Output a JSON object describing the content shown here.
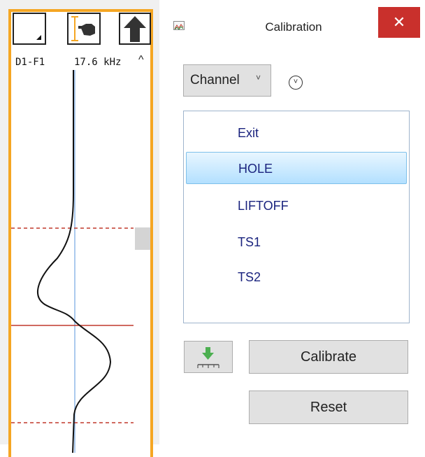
{
  "strip": {
    "channel_label": "D1-F1",
    "frequency_label": "17.6 kHz",
    "scroll_up_glyph": "^",
    "toolbar_icons": [
      "corner-toggle-icon",
      "hand-pointer-icon",
      "up-arrow-icon"
    ]
  },
  "dialog": {
    "title": "Calibration",
    "close_glyph": "✕",
    "channel_dropdown": {
      "value": "Channel",
      "chevron": "˅"
    },
    "expand_glyph": "˅",
    "list_items": [
      "Exit",
      "HOLE",
      "LIFTOFF",
      "TS1",
      "TS2"
    ],
    "selected_item": "HOLE",
    "calibrate_label": "Calibrate",
    "reset_label": "Reset"
  },
  "colors": {
    "strip_border": "#f5a623",
    "center_line": "#8fb8e8",
    "marker_line": "#c0392b",
    "close_button": "#c9302c",
    "list_text": "#1a237e"
  }
}
